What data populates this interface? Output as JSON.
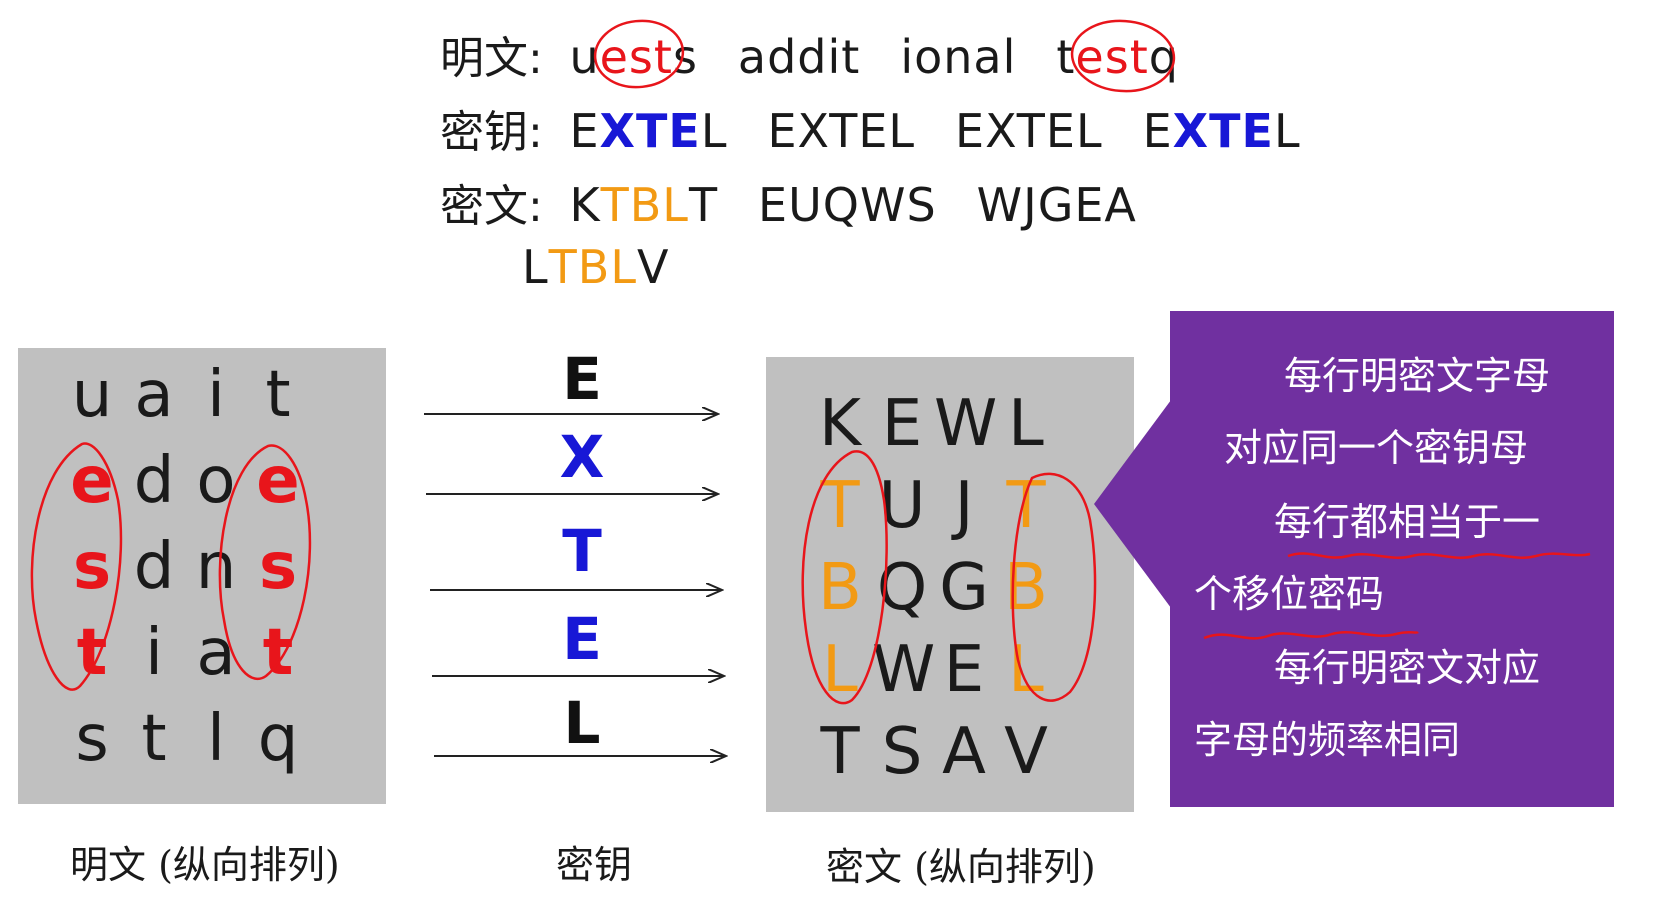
{
  "top": {
    "plaintext": {
      "label": "明文:",
      "words": [
        [
          {
            "t": "u",
            "c": ""
          },
          {
            "t": "e",
            "c": "red"
          },
          {
            "t": "s",
            "c": "red"
          },
          {
            "t": "t",
            "c": "red"
          },
          {
            "t": "s",
            "c": ""
          }
        ],
        [
          {
            "t": "addit",
            "c": ""
          }
        ],
        [
          {
            "t": "ional",
            "c": ""
          }
        ],
        [
          {
            "t": "t",
            "c": ""
          },
          {
            "t": "e",
            "c": "red"
          },
          {
            "t": "s",
            "c": "red"
          },
          {
            "t": "t",
            "c": "red"
          },
          {
            "t": "q",
            "c": ""
          }
        ]
      ]
    },
    "key": {
      "label": "密钥:",
      "words": [
        [
          {
            "t": "E",
            "c": ""
          },
          {
            "t": "X",
            "c": "blue"
          },
          {
            "t": "T",
            "c": "blue"
          },
          {
            "t": "E",
            "c": "blue"
          },
          {
            "t": "L",
            "c": ""
          }
        ],
        [
          {
            "t": "EXTEL",
            "c": ""
          }
        ],
        [
          {
            "t": "EXTEL",
            "c": ""
          }
        ],
        [
          {
            "t": "E",
            "c": ""
          },
          {
            "t": "X",
            "c": "blue"
          },
          {
            "t": "T",
            "c": "blue"
          },
          {
            "t": "E",
            "c": "blue"
          },
          {
            "t": "L",
            "c": ""
          }
        ]
      ]
    },
    "ciphertext": {
      "label": "密文:",
      "words": [
        [
          {
            "t": "K",
            "c": ""
          },
          {
            "t": "T",
            "c": "orange"
          },
          {
            "t": "B",
            "c": "orange"
          },
          {
            "t": "L",
            "c": "orange"
          },
          {
            "t": "T",
            "c": ""
          }
        ],
        [
          {
            "t": "EUQWS",
            "c": ""
          }
        ],
        [
          {
            "t": "WJGEA",
            "c": ""
          }
        ]
      ],
      "wrap": [
        {
          "t": "L",
          "c": ""
        },
        {
          "t": "T",
          "c": "orange"
        },
        {
          "t": "B",
          "c": "orange"
        },
        {
          "t": "L",
          "c": "orange"
        },
        {
          "t": "V",
          "c": ""
        }
      ]
    }
  },
  "plain_grid": {
    "rows": [
      [
        {
          "t": "u",
          "h": ""
        },
        {
          "t": "a",
          "h": ""
        },
        {
          "t": "i",
          "h": ""
        },
        {
          "t": "t",
          "h": ""
        }
      ],
      [
        {
          "t": "e",
          "h": "red"
        },
        {
          "t": "d",
          "h": ""
        },
        {
          "t": "o",
          "h": ""
        },
        {
          "t": "e",
          "h": "red"
        }
      ],
      [
        {
          "t": "s",
          "h": "red"
        },
        {
          "t": "d",
          "h": ""
        },
        {
          "t": "n",
          "h": ""
        },
        {
          "t": "s",
          "h": "red"
        }
      ],
      [
        {
          "t": "t",
          "h": "red"
        },
        {
          "t": "i",
          "h": ""
        },
        {
          "t": "a",
          "h": ""
        },
        {
          "t": "t",
          "h": "red"
        }
      ],
      [
        {
          "t": "s",
          "h": ""
        },
        {
          "t": "t",
          "h": ""
        },
        {
          "t": "l",
          "h": ""
        },
        {
          "t": "q",
          "h": ""
        }
      ]
    ],
    "caption": "明文 (纵向排列)"
  },
  "key_column": {
    "letters": [
      {
        "t": "E",
        "c": "black"
      },
      {
        "t": "X",
        "c": "blue"
      },
      {
        "t": "T",
        "c": "blue"
      },
      {
        "t": "E",
        "c": "blue"
      },
      {
        "t": "L",
        "c": "black"
      }
    ],
    "caption": "密钥"
  },
  "cipher_grid": {
    "rows": [
      [
        {
          "t": "K",
          "h": ""
        },
        {
          "t": "E",
          "h": ""
        },
        {
          "t": "W",
          "h": ""
        },
        {
          "t": "L",
          "h": ""
        }
      ],
      [
        {
          "t": "T",
          "h": "orange"
        },
        {
          "t": "U",
          "h": ""
        },
        {
          "t": "J",
          "h": ""
        },
        {
          "t": "T",
          "h": "orange"
        }
      ],
      [
        {
          "t": "B",
          "h": "orange"
        },
        {
          "t": "Q",
          "h": ""
        },
        {
          "t": "G",
          "h": ""
        },
        {
          "t": "B",
          "h": "orange"
        }
      ],
      [
        {
          "t": "L",
          "h": "orange"
        },
        {
          "t": "W",
          "h": ""
        },
        {
          "t": "E",
          "h": ""
        },
        {
          "t": "L",
          "h": "orange"
        }
      ],
      [
        {
          "t": "T",
          "h": ""
        },
        {
          "t": "S",
          "h": ""
        },
        {
          "t": "A",
          "h": ""
        },
        {
          "t": "V",
          "h": ""
        }
      ]
    ],
    "caption": "密文 (纵向排列)"
  },
  "callout": {
    "line1": "每行明密文字母",
    "line2": "对应同一个密钥母",
    "line3": "每行都相当于一",
    "line4": "个移位密码",
    "line5": "每行明密文对应",
    "line6": "字母的频率相同"
  },
  "colors": {
    "red": "#e8151b",
    "blue": "#1818d6",
    "orange": "#f29a14",
    "purple": "#7030a0",
    "panel_gray": "#c0c0c0"
  }
}
